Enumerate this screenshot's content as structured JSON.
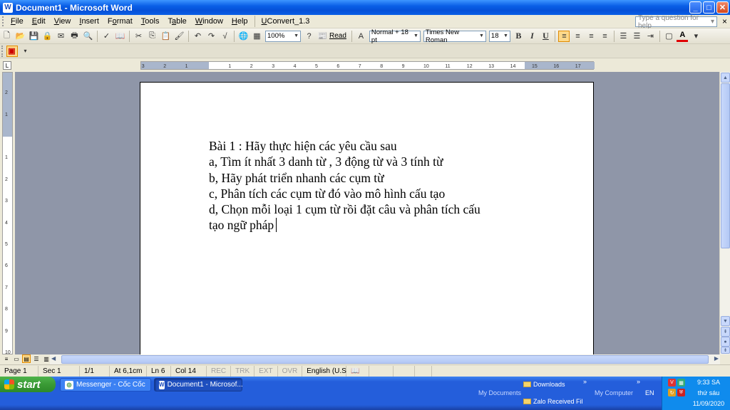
{
  "window": {
    "title": "Document1 - Microsoft Word",
    "app_icon": "W"
  },
  "window_buttons": {
    "minimize": "_",
    "maximize": "□",
    "close": "✕"
  },
  "menu": {
    "items": [
      {
        "label": "File",
        "key": "F"
      },
      {
        "label": "Edit",
        "key": "E"
      },
      {
        "label": "View",
        "key": "V"
      },
      {
        "label": "Insert",
        "key": "I"
      },
      {
        "label": "Format",
        "key": "o"
      },
      {
        "label": "Tools",
        "key": "T"
      },
      {
        "label": "Table",
        "key": "a"
      },
      {
        "label": "Window",
        "key": "W"
      },
      {
        "label": "Help",
        "key": "H"
      },
      {
        "label": "UConvert_1.3",
        "key": "U"
      }
    ],
    "help_placeholder": "Type a question for help",
    "close_glyph": "×"
  },
  "toolbar": {
    "zoom": "100%",
    "read_label": "Read",
    "style": "Normal + 18 pt",
    "font": "Times New Roman",
    "size": "18",
    "bold": "B",
    "italic": "I",
    "underline": "U",
    "font_color_glyph": "A"
  },
  "ruler": {
    "h_ticks": [
      "3",
      "2",
      "1",
      "1",
      "2",
      "3",
      "4",
      "5",
      "6",
      "7",
      "8",
      "9",
      "10",
      "11",
      "12",
      "13",
      "14",
      "15",
      "16",
      "17"
    ],
    "v_ticks": [
      "2",
      "1",
      "1",
      "2",
      "3",
      "4",
      "5",
      "6",
      "7",
      "8",
      "9",
      "10"
    ]
  },
  "document": {
    "lines": [
      "Bài 1 : Hãy thực hiện các yêu cầu sau",
      "a, Tìm ít nhất 3 danh từ , 3 động từ và 3 tính từ",
      "b, Hãy phát triển nhanh các cụm từ",
      "c, Phân tích các cụm từ đó vào mô hình cấu tạo",
      "d, Chọn mỗi loại 1 cụm từ rồi đặt câu và phân tích cấu",
      "tạo ngữ pháp"
    ]
  },
  "status": {
    "page": "Page 1",
    "sec": "Sec 1",
    "pages": "1/1",
    "at": "At 6,1cm",
    "ln": "Ln 6",
    "col": "Col 14",
    "rec": "REC",
    "trk": "TRK",
    "ext": "EXT",
    "ovr": "OVR",
    "language": "English (U.S"
  },
  "taskbar": {
    "start": "start",
    "tasks": [
      {
        "label": "Messenger - Cốc Cốc"
      },
      {
        "label": "Document1 - Microsof..."
      }
    ],
    "my_documents": "My Documents",
    "downloads": "Downloads",
    "zalo": "Zalo Received Fil",
    "my_computer": "My Computer",
    "lang": "EN",
    "chevron": "»",
    "clock_time": "9:33 SA",
    "clock_day": "thứ sáu",
    "clock_date": "11/09/2020"
  },
  "colors": {
    "titlebar": "#0a5fe6",
    "taskbar": "#245edb",
    "start_green": "#3a9a35",
    "workspace": "#8f96a8",
    "tray": "#0f8bed"
  }
}
